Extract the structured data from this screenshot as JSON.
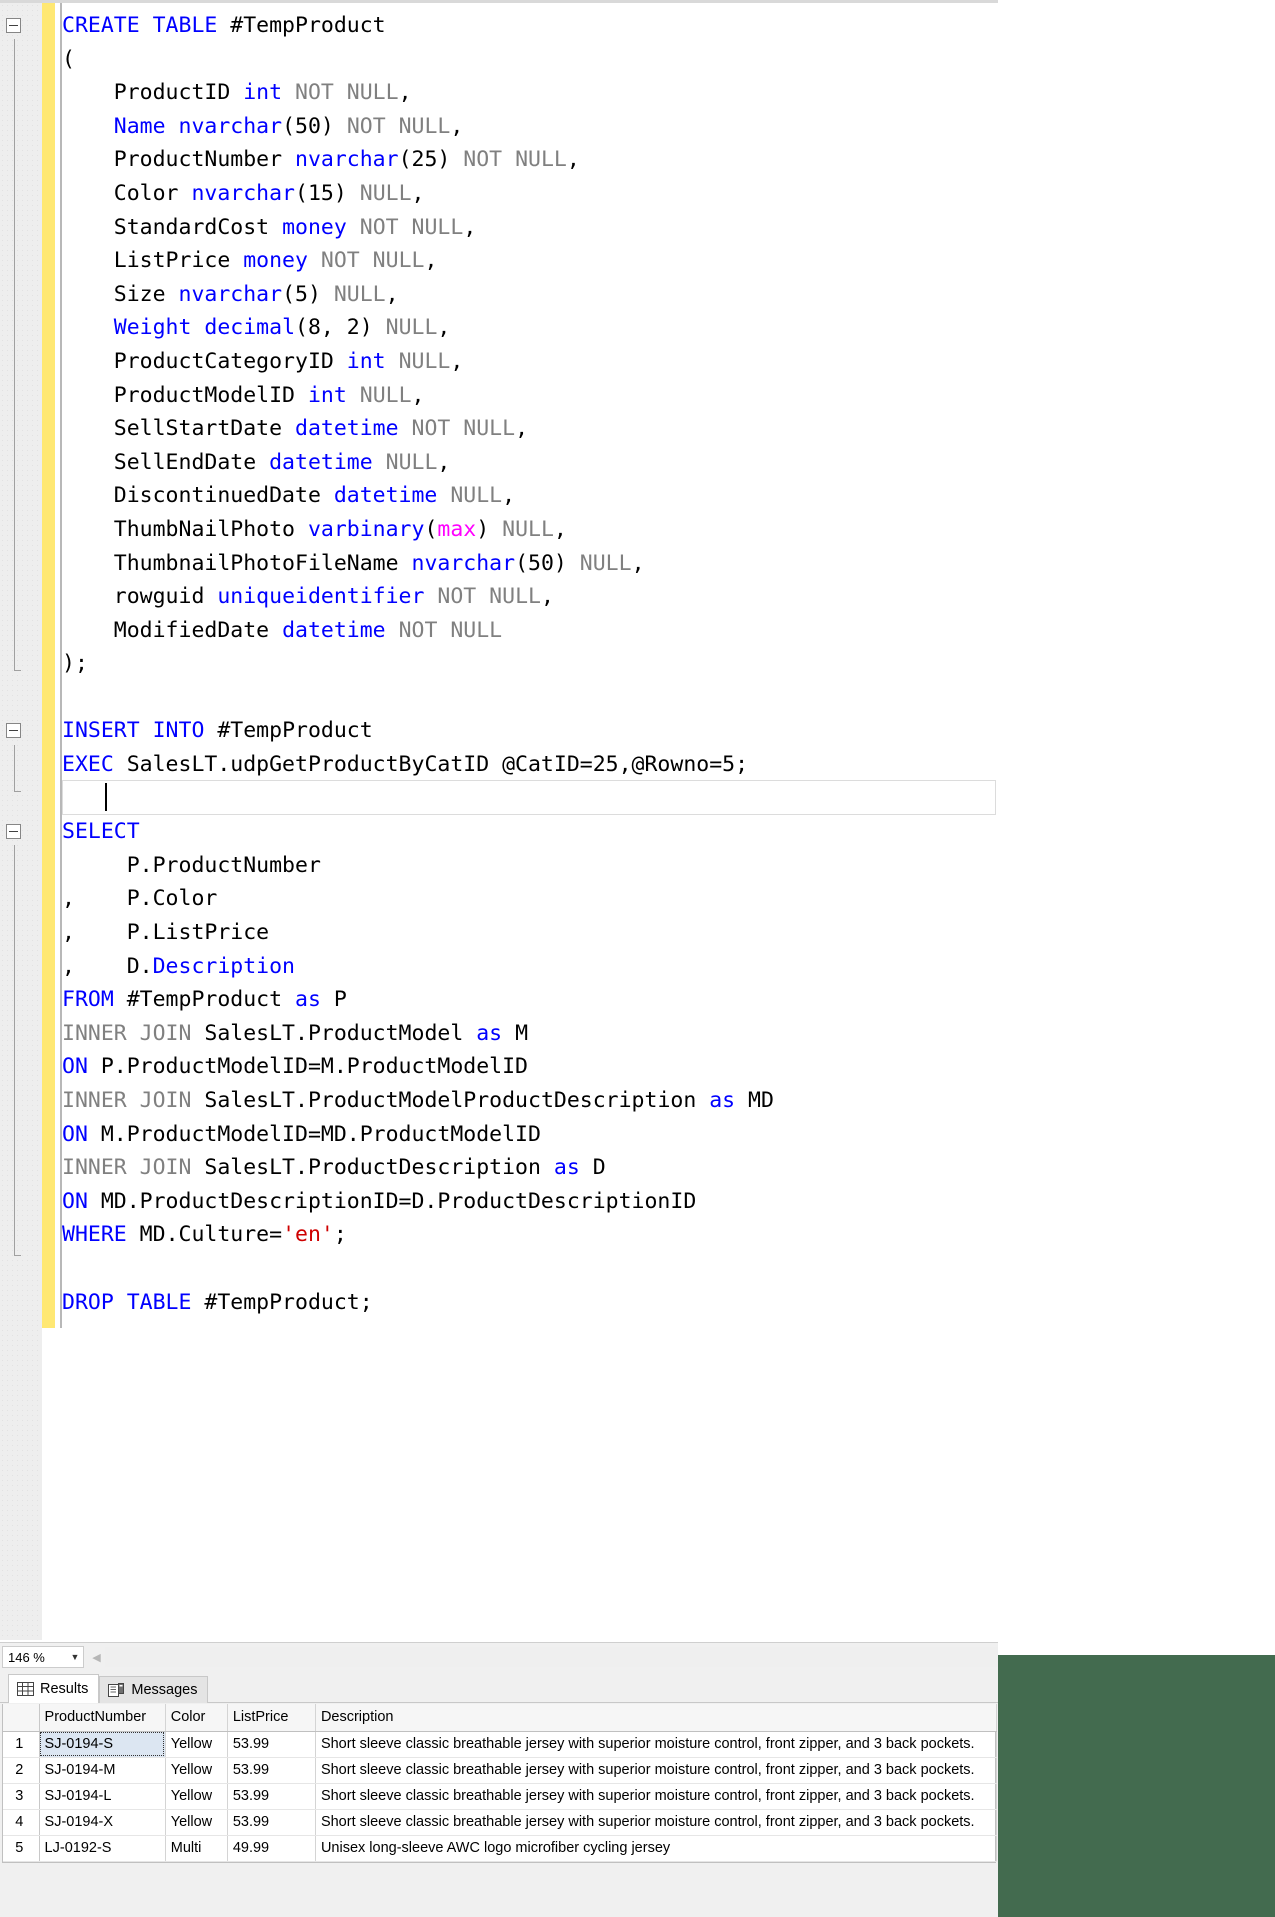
{
  "editor": {
    "language": "T-SQL",
    "zoom_level": "146 %",
    "zoom_dropdown_arrow": "chevron-down-icon",
    "code_lines": [
      {
        "fold": true,
        "tokens": [
          {
            "t": "CREATE TABLE ",
            "c": "kw"
          },
          {
            "t": "#TempProduct",
            "c": "pl"
          }
        ]
      },
      {
        "tokens": [
          {
            "t": "(",
            "c": "pl"
          }
        ]
      },
      {
        "tokens": [
          {
            "t": "    ProductID ",
            "c": "pl"
          },
          {
            "t": "int",
            "c": "typ"
          },
          {
            "t": " ",
            "c": "pl"
          },
          {
            "t": "NOT NULL",
            "c": "kwg"
          },
          {
            "t": ",",
            "c": "pl"
          }
        ]
      },
      {
        "tokens": [
          {
            "t": "    ",
            "c": "pl"
          },
          {
            "t": "Name",
            "c": "kw"
          },
          {
            "t": " ",
            "c": "pl"
          },
          {
            "t": "nvarchar",
            "c": "typ"
          },
          {
            "t": "(50) ",
            "c": "pl"
          },
          {
            "t": "NOT NULL",
            "c": "kwg"
          },
          {
            "t": ",",
            "c": "pl"
          }
        ]
      },
      {
        "tokens": [
          {
            "t": "    ProductNumber ",
            "c": "pl"
          },
          {
            "t": "nvarchar",
            "c": "typ"
          },
          {
            "t": "(25) ",
            "c": "pl"
          },
          {
            "t": "NOT NULL",
            "c": "kwg"
          },
          {
            "t": ",",
            "c": "pl"
          }
        ]
      },
      {
        "tokens": [
          {
            "t": "    Color ",
            "c": "pl"
          },
          {
            "t": "nvarchar",
            "c": "typ"
          },
          {
            "t": "(15) ",
            "c": "pl"
          },
          {
            "t": "NULL",
            "c": "kwg"
          },
          {
            "t": ",",
            "c": "pl"
          }
        ]
      },
      {
        "tokens": [
          {
            "t": "    StandardCost ",
            "c": "pl"
          },
          {
            "t": "money",
            "c": "typ"
          },
          {
            "t": " ",
            "c": "pl"
          },
          {
            "t": "NOT NULL",
            "c": "kwg"
          },
          {
            "t": ",",
            "c": "pl"
          }
        ]
      },
      {
        "tokens": [
          {
            "t": "    ListPrice ",
            "c": "pl"
          },
          {
            "t": "money",
            "c": "typ"
          },
          {
            "t": " ",
            "c": "pl"
          },
          {
            "t": "NOT NULL",
            "c": "kwg"
          },
          {
            "t": ",",
            "c": "pl"
          }
        ]
      },
      {
        "tokens": [
          {
            "t": "    Size ",
            "c": "pl"
          },
          {
            "t": "nvarchar",
            "c": "typ"
          },
          {
            "t": "(5) ",
            "c": "pl"
          },
          {
            "t": "NULL",
            "c": "kwg"
          },
          {
            "t": ",",
            "c": "pl"
          }
        ]
      },
      {
        "tokens": [
          {
            "t": "    ",
            "c": "pl"
          },
          {
            "t": "Weight",
            "c": "kw"
          },
          {
            "t": " ",
            "c": "pl"
          },
          {
            "t": "decimal",
            "c": "typ"
          },
          {
            "t": "(8, 2) ",
            "c": "pl"
          },
          {
            "t": "NULL",
            "c": "kwg"
          },
          {
            "t": ",",
            "c": "pl"
          }
        ]
      },
      {
        "tokens": [
          {
            "t": "    ProductCategoryID ",
            "c": "pl"
          },
          {
            "t": "int",
            "c": "typ"
          },
          {
            "t": " ",
            "c": "pl"
          },
          {
            "t": "NULL",
            "c": "kwg"
          },
          {
            "t": ",",
            "c": "pl"
          }
        ]
      },
      {
        "tokens": [
          {
            "t": "    ProductModelID ",
            "c": "pl"
          },
          {
            "t": "int",
            "c": "typ"
          },
          {
            "t": " ",
            "c": "pl"
          },
          {
            "t": "NULL",
            "c": "kwg"
          },
          {
            "t": ",",
            "c": "pl"
          }
        ]
      },
      {
        "tokens": [
          {
            "t": "    SellStartDate ",
            "c": "pl"
          },
          {
            "t": "datetime",
            "c": "typ"
          },
          {
            "t": " ",
            "c": "pl"
          },
          {
            "t": "NOT NULL",
            "c": "kwg"
          },
          {
            "t": ",",
            "c": "pl"
          }
        ]
      },
      {
        "tokens": [
          {
            "t": "    SellEndDate ",
            "c": "pl"
          },
          {
            "t": "datetime",
            "c": "typ"
          },
          {
            "t": " ",
            "c": "pl"
          },
          {
            "t": "NULL",
            "c": "kwg"
          },
          {
            "t": ",",
            "c": "pl"
          }
        ]
      },
      {
        "tokens": [
          {
            "t": "    DiscontinuedDate ",
            "c": "pl"
          },
          {
            "t": "datetime",
            "c": "typ"
          },
          {
            "t": " ",
            "c": "pl"
          },
          {
            "t": "NULL",
            "c": "kwg"
          },
          {
            "t": ",",
            "c": "pl"
          }
        ]
      },
      {
        "tokens": [
          {
            "t": "    ThumbNailPhoto ",
            "c": "pl"
          },
          {
            "t": "varbinary",
            "c": "typ"
          },
          {
            "t": "(",
            "c": "pl"
          },
          {
            "t": "max",
            "c": "mx"
          },
          {
            "t": ") ",
            "c": "pl"
          },
          {
            "t": "NULL",
            "c": "kwg"
          },
          {
            "t": ",",
            "c": "pl"
          }
        ]
      },
      {
        "tokens": [
          {
            "t": "    ThumbnailPhotoFileName ",
            "c": "pl"
          },
          {
            "t": "nvarchar",
            "c": "typ"
          },
          {
            "t": "(50) ",
            "c": "pl"
          },
          {
            "t": "NULL",
            "c": "kwg"
          },
          {
            "t": ",",
            "c": "pl"
          }
        ]
      },
      {
        "tokens": [
          {
            "t": "    rowguid ",
            "c": "pl"
          },
          {
            "t": "uniqueidentifier",
            "c": "typ"
          },
          {
            "t": " ",
            "c": "pl"
          },
          {
            "t": "NOT NULL",
            "c": "kwg"
          },
          {
            "t": ",",
            "c": "pl"
          }
        ]
      },
      {
        "tokens": [
          {
            "t": "    ModifiedDate ",
            "c": "pl"
          },
          {
            "t": "datetime",
            "c": "typ"
          },
          {
            "t": " ",
            "c": "pl"
          },
          {
            "t": "NOT NULL",
            "c": "kwg"
          }
        ]
      },
      {
        "tokens": [
          {
            "t": ");",
            "c": "pl"
          }
        ]
      },
      {
        "tokens": []
      },
      {
        "fold": true,
        "tokens": [
          {
            "t": "INSERT INTO ",
            "c": "kw"
          },
          {
            "t": "#TempProduct",
            "c": "pl"
          }
        ]
      },
      {
        "tokens": [
          {
            "t": "EXEC",
            "c": "kw"
          },
          {
            "t": " SalesLT.udpGetProductByCatID @CatID=25,@Rowno=5;",
            "c": "pl"
          }
        ]
      },
      {
        "tokens": []
      },
      {
        "fold": true,
        "tokens": [
          {
            "t": "SELECT",
            "c": "kw"
          }
        ]
      },
      {
        "tokens": [
          {
            "t": "     P.ProductNumber",
            "c": "pl"
          }
        ]
      },
      {
        "tokens": [
          {
            "t": ",    P.Color",
            "c": "pl"
          }
        ]
      },
      {
        "tokens": [
          {
            "t": ",    P.ListPrice",
            "c": "pl"
          }
        ]
      },
      {
        "tokens": [
          {
            "t": ",    D.",
            "c": "pl"
          },
          {
            "t": "Description",
            "c": "kw"
          }
        ]
      },
      {
        "tokens": [
          {
            "t": "FROM",
            "c": "kw"
          },
          {
            "t": " #TempProduct ",
            "c": "pl"
          },
          {
            "t": "as",
            "c": "kw"
          },
          {
            "t": " P",
            "c": "pl"
          }
        ]
      },
      {
        "tokens": [
          {
            "t": "INNER JOIN",
            "c": "kwg"
          },
          {
            "t": " SalesLT.ProductModel ",
            "c": "pl"
          },
          {
            "t": "as",
            "c": "kw"
          },
          {
            "t": " M",
            "c": "pl"
          }
        ]
      },
      {
        "tokens": [
          {
            "t": "ON",
            "c": "kw"
          },
          {
            "t": " P.ProductModelID=M.ProductModelID",
            "c": "pl"
          }
        ]
      },
      {
        "tokens": [
          {
            "t": "INNER JOIN",
            "c": "kwg"
          },
          {
            "t": " SalesLT.ProductModelProductDescription ",
            "c": "pl"
          },
          {
            "t": "as",
            "c": "kw"
          },
          {
            "t": " MD",
            "c": "pl"
          }
        ]
      },
      {
        "tokens": [
          {
            "t": "ON",
            "c": "kw"
          },
          {
            "t": " M.ProductModelID=MD.ProductModelID",
            "c": "pl"
          }
        ]
      },
      {
        "tokens": [
          {
            "t": "INNER JOIN",
            "c": "kwg"
          },
          {
            "t": " SalesLT.ProductDescription ",
            "c": "pl"
          },
          {
            "t": "as",
            "c": "kw"
          },
          {
            "t": " D",
            "c": "pl"
          }
        ]
      },
      {
        "tokens": [
          {
            "t": "ON",
            "c": "kw"
          },
          {
            "t": " MD.ProductDescriptionID=D.ProductDescriptionID",
            "c": "pl"
          }
        ]
      },
      {
        "tokens": [
          {
            "t": "WHERE",
            "c": "kw"
          },
          {
            "t": " MD.Culture=",
            "c": "pl"
          },
          {
            "t": "'en'",
            "c": "str"
          },
          {
            "t": ";",
            "c": "pl"
          }
        ]
      },
      {
        "tokens": []
      },
      {
        "tokens": [
          {
            "t": "DROP TABLE ",
            "c": "kw"
          },
          {
            "t": "#TempProduct;",
            "c": "pl"
          }
        ]
      }
    ]
  },
  "results_pane": {
    "tabs": [
      {
        "label": "Results",
        "icon": "grid-icon",
        "active": true
      },
      {
        "label": "Messages",
        "icon": "messages-icon",
        "active": false
      }
    ],
    "grid": {
      "columns": [
        "ProductNumber",
        "Color",
        "ListPrice",
        "Description"
      ],
      "rows": [
        {
          "n": "1",
          "ProductNumber": "SJ-0194-S",
          "Color": "Yellow",
          "ListPrice": "53.99",
          "Description": "Short sleeve classic breathable jersey with superior moisture control, front zipper, and 3 back pockets.",
          "selected": true
        },
        {
          "n": "2",
          "ProductNumber": "SJ-0194-M",
          "Color": "Yellow",
          "ListPrice": "53.99",
          "Description": "Short sleeve classic breathable jersey with superior moisture control, front zipper, and 3 back pockets.",
          "selected": false
        },
        {
          "n": "3",
          "ProductNumber": "SJ-0194-L",
          "Color": "Yellow",
          "ListPrice": "53.99",
          "Description": "Short sleeve classic breathable jersey with superior moisture control, front zipper, and 3 back pockets.",
          "selected": false
        },
        {
          "n": "4",
          "ProductNumber": "SJ-0194-X",
          "Color": "Yellow",
          "ListPrice": "53.99",
          "Description": "Short sleeve classic breathable jersey with superior moisture control, front zipper, and 3 back pockets.",
          "selected": false
        },
        {
          "n": "5",
          "ProductNumber": "LJ-0192-S",
          "Color": "Multi",
          "ListPrice": "49.99",
          "Description": "Unisex long-sleeve AWC logo microfiber cycling jersey",
          "selected": false
        }
      ]
    }
  },
  "colors": {
    "keyword_blue": "#0000ff",
    "keyword_gray": "#808080",
    "string_red": "#ce0000",
    "magenta": "#ff00ff",
    "change_bar_yellow": "#ffe873",
    "accent_green": "#436b4f"
  }
}
